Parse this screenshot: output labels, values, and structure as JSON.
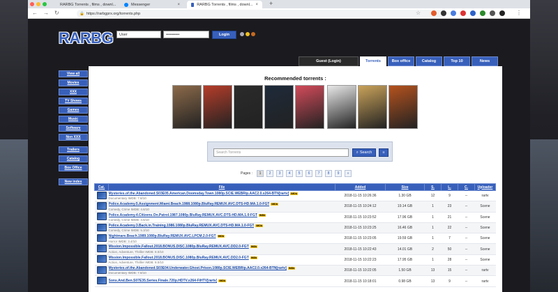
{
  "browser": {
    "tabs": [
      {
        "title": "RARBG Torrents , films , downl...",
        "active": false
      },
      {
        "title": "Messenger",
        "active": false
      },
      {
        "title": "RARBG Torrents , films , downl...",
        "active": true
      }
    ],
    "new_tab": "+",
    "url": "https://rarbgprx.org/torrents.php"
  },
  "site": {
    "logo": "RARBG",
    "login": {
      "username_value": "User",
      "password_value": "••••••••••",
      "button": "Login"
    },
    "topnav": [
      {
        "label": "Guest (Login)"
      },
      {
        "label": "Torrents",
        "active": true
      },
      {
        "label": "Box office"
      },
      {
        "label": "Catalog"
      },
      {
        "label": "Top 10"
      },
      {
        "label": "News"
      }
    ],
    "sidebar": [
      {
        "label": "View all"
      },
      {
        "label": "Movies"
      },
      {
        "label": "XXX"
      },
      {
        "label": "TV Shows"
      },
      {
        "label": "Games"
      },
      {
        "label": "Music"
      },
      {
        "label": "Software"
      },
      {
        "label": "Non XXX"
      },
      {
        "label": "Trailers"
      },
      {
        "label": "Catalog"
      },
      {
        "label": "Box Office"
      },
      {
        "label": "New index"
      }
    ],
    "recommended_title": "Recommended torrents :",
    "posters": [
      "#8c6a4a",
      "#b53d2a",
      "#2b2b2b",
      "#1e2a3a",
      "#d24b5a",
      "#e8e8e8",
      "#c9a25a",
      "#b4521e"
    ],
    "search": {
      "placeholder": "Search Torrents",
      "button": "Search",
      "toggle": "≡"
    },
    "pager": {
      "label": "Pages :",
      "pages": [
        "1",
        "2",
        "3",
        "4",
        "5",
        "6",
        "7",
        "8",
        "9",
        "»"
      ]
    },
    "table": {
      "headers": [
        "Cat.",
        "File",
        "Added",
        "Size",
        "S.",
        "L.",
        "C.",
        "Uploader"
      ],
      "rows": [
        {
          "title": "Mysteries.of.the.Abandoned.S03E05.American.Doomsday.Town.1080p.SCIE.WEBRip.AAC2.0.x264-BTN[rartv]",
          "genre": "Documentary IMDB: 7.8/10",
          "added": "2018-11-15 10:26:36",
          "size": "1.30 GB",
          "s": "12",
          "l": "9",
          "c": "--",
          "uploader": "rartv"
        },
        {
          "title": "Police.Academy.5.Assignment.Miami.Beach.1988.1080p.BluRay.REMUX.AVC.DTS-HD.MA.1.0-FGT",
          "genre": "Comedy, Crime IMDB: 4.6/10",
          "added": "2018-11-15 10:24:12",
          "size": "19.14 GB",
          "s": "1",
          "l": "23",
          "c": "--",
          "uploader": "Scene"
        },
        {
          "title": "Police.Academy.4.Citizens.On.Patrol.1987.1080p.BluRay.REMUX.AVC.DTS-HD.MA.1.0-FGT",
          "genre": "Comedy, Crime IMDB: 4.6/10",
          "added": "2018-11-15 10:23:52",
          "size": "17.96 GB",
          "s": "1",
          "l": "21",
          "c": "--",
          "uploader": "Scene"
        },
        {
          "title": "Police.Academy.3.Back.in.Training.1986.1080p.BluRay.REMUX.AVC.DTS-HD.MA.1.0-FGT",
          "genre": "Comedy, Crime IMDB: 5.3/10",
          "added": "2018-11-15 10:23:25",
          "size": "16.46 GB",
          "s": "1",
          "l": "22",
          "c": "--",
          "uploader": "Scene"
        },
        {
          "title": "Nightmare.Beach.1989.1080p.BluRay.REMUX.AVC.LPCM.2.0-FGT",
          "genre": "Horror IMDB: 3.4/10",
          "added": "2018-11-15 10:23:05",
          "size": "19.59 GB",
          "s": "1",
          "l": "7",
          "c": "--",
          "uploader": "Scene"
        },
        {
          "title": "Mission.Impossible.Fallout.2018.BONUS.DISC.1080p.BluRay.REMUX.AVC.DD2.0-FGT",
          "genre": "Action, Adventure, Thriller IMDB: 8.0/10",
          "added": "2018-11-15 10:22:43",
          "size": "14.01 GB",
          "s": "2",
          "l": "50",
          "c": "--",
          "uploader": "Scene"
        },
        {
          "title": "Mission.Impossible.Fallout.2018.BONUS.DISC.1080p.BluRay.REMUX.AVC.DD2.0-FGT",
          "genre": "Action, Adventure, Thriller IMDB: 8.0/10",
          "added": "2018-11-15 10:22:23",
          "size": "17.95 GB",
          "s": "1",
          "l": "28",
          "c": "--",
          "uploader": "Scene"
        },
        {
          "title": "Mysteries.of.the.Abandoned.S03E04.Underwater.Ghost.Prison.1080p.SCIE.WEBRip.AAC2.0.x264-BTN[rartv]",
          "genre": "Documentary IMDB: 7.8/10",
          "added": "2018-11-15 10:22:05",
          "size": "1.50 GB",
          "s": "13",
          "l": "15",
          "c": "--",
          "uploader": "rartv"
        },
        {
          "title": "Sons.And.Ben.S07E35.Series.Finale.720p.HDTV.x264-FiHTV[rartv]",
          "genre": "",
          "added": "2018-11-15 10:18:01",
          "size": "0.98 GB",
          "s": "13",
          "l": "9",
          "c": "--",
          "uploader": "rartv"
        }
      ]
    }
  }
}
